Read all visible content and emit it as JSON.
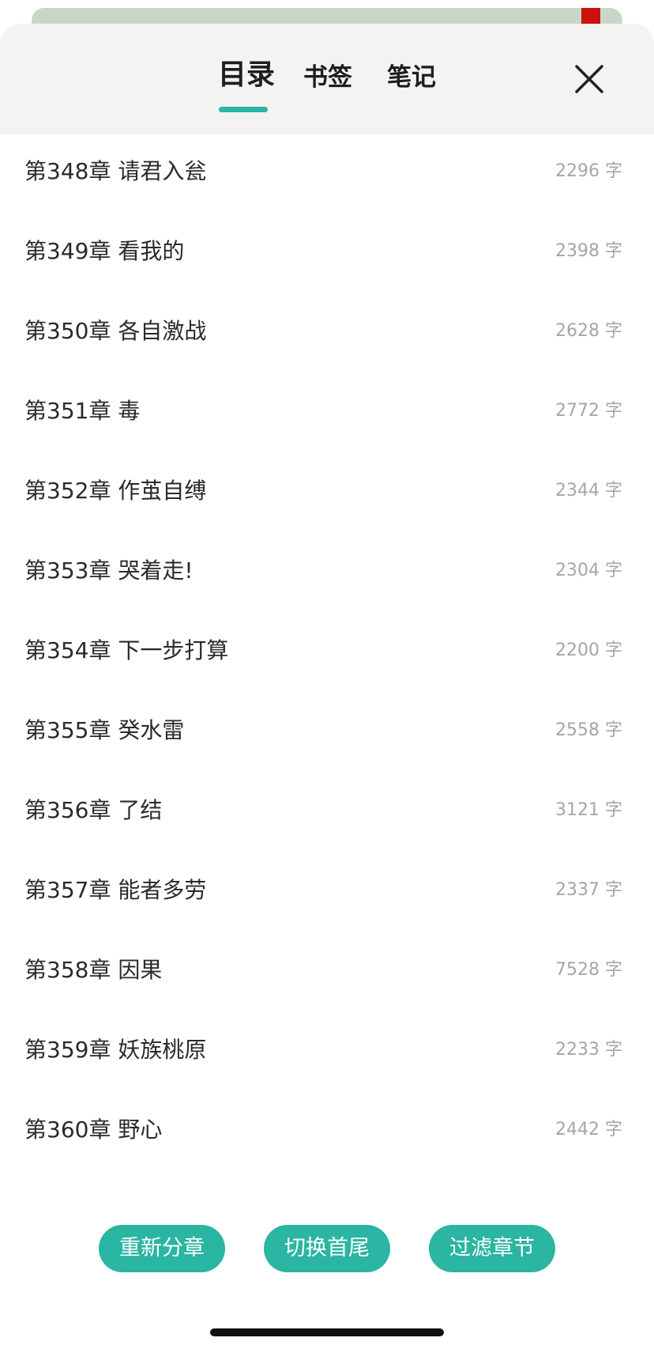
{
  "tabs": [
    {
      "label": "目录",
      "active": true
    },
    {
      "label": "书签",
      "active": false
    },
    {
      "label": "笔记",
      "active": false
    }
  ],
  "chapters": [
    {
      "title": "第348章 请君入瓮",
      "count": "2296 字"
    },
    {
      "title": "第349章 看我的",
      "count": "2398 字"
    },
    {
      "title": "第350章 各自激战",
      "count": "2628 字"
    },
    {
      "title": "第351章 毒",
      "count": "2772 字"
    },
    {
      "title": "第352章 作茧自缚",
      "count": "2344 字"
    },
    {
      "title": "第353章 哭着走!",
      "count": "2304 字"
    },
    {
      "title": "第354章 下一步打算",
      "count": "2200 字"
    },
    {
      "title": "第355章 癸水雷",
      "count": "2558 字"
    },
    {
      "title": "第356章 了结",
      "count": "3121 字"
    },
    {
      "title": "第357章 能者多劳",
      "count": "2337 字"
    },
    {
      "title": "第358章 因果",
      "count": "7528 字"
    },
    {
      "title": "第359章 妖族桃原",
      "count": "2233 字"
    },
    {
      "title": "第360章 野心",
      "count": "2442 字"
    }
  ],
  "actions": {
    "resplit": "重新分章",
    "switch_ends": "切换首尾",
    "filter": "过滤章节"
  },
  "colors": {
    "accent": "#2bb5a3",
    "header_bg": "#f3f3f1",
    "count_text": "#a6a6a6"
  },
  "icons": {
    "close": "close-icon"
  }
}
